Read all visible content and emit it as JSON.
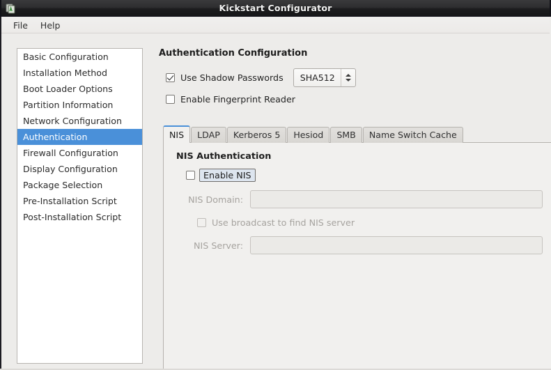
{
  "window": {
    "title": "Kickstart Configurator",
    "icon": "app-document-icon"
  },
  "menubar": {
    "items": [
      {
        "label": "File"
      },
      {
        "label": "Help"
      }
    ]
  },
  "sidebar": {
    "items": [
      {
        "label": "Basic Configuration",
        "selected": false
      },
      {
        "label": "Installation Method",
        "selected": false
      },
      {
        "label": "Boot Loader Options",
        "selected": false
      },
      {
        "label": "Partition Information",
        "selected": false
      },
      {
        "label": "Network Configuration",
        "selected": false
      },
      {
        "label": "Authentication",
        "selected": true
      },
      {
        "label": "Firewall Configuration",
        "selected": false
      },
      {
        "label": "Display Configuration",
        "selected": false
      },
      {
        "label": "Package Selection",
        "selected": false
      },
      {
        "label": "Pre-Installation Script",
        "selected": false
      },
      {
        "label": "Post-Installation Script",
        "selected": false
      }
    ]
  },
  "main": {
    "page_title": "Authentication Configuration",
    "shadow_passwords": {
      "label": "Use Shadow Passwords",
      "checked": true
    },
    "hash_algorithm": {
      "value": "SHA512",
      "arrows_icon": "spinner-updown-icon"
    },
    "fingerprint_reader": {
      "label": "Enable Fingerprint Reader",
      "checked": false
    },
    "tabs": [
      {
        "label": "NIS",
        "active": true
      },
      {
        "label": "LDAP",
        "active": false
      },
      {
        "label": "Kerberos 5",
        "active": false
      },
      {
        "label": "Hesiod",
        "active": false
      },
      {
        "label": "SMB",
        "active": false
      },
      {
        "label": "Name Switch Cache",
        "active": false
      }
    ],
    "nis_panel": {
      "section_title": "NIS Authentication",
      "enable_nis": {
        "label": "Enable NIS",
        "checked": false,
        "focused": true
      },
      "nis_domain": {
        "label": "NIS Domain:",
        "value": "",
        "enabled": false
      },
      "use_broadcast": {
        "label": "Use broadcast to find NIS server",
        "checked": false,
        "enabled": false
      },
      "nis_server": {
        "label": "NIS Server:",
        "value": "",
        "enabled": false
      }
    }
  },
  "colors": {
    "selection_blue": "#4a90d9",
    "titlebar_dark": "#1d1d1f",
    "panel_bg": "#f1f0ee",
    "window_bg": "#edecea"
  }
}
